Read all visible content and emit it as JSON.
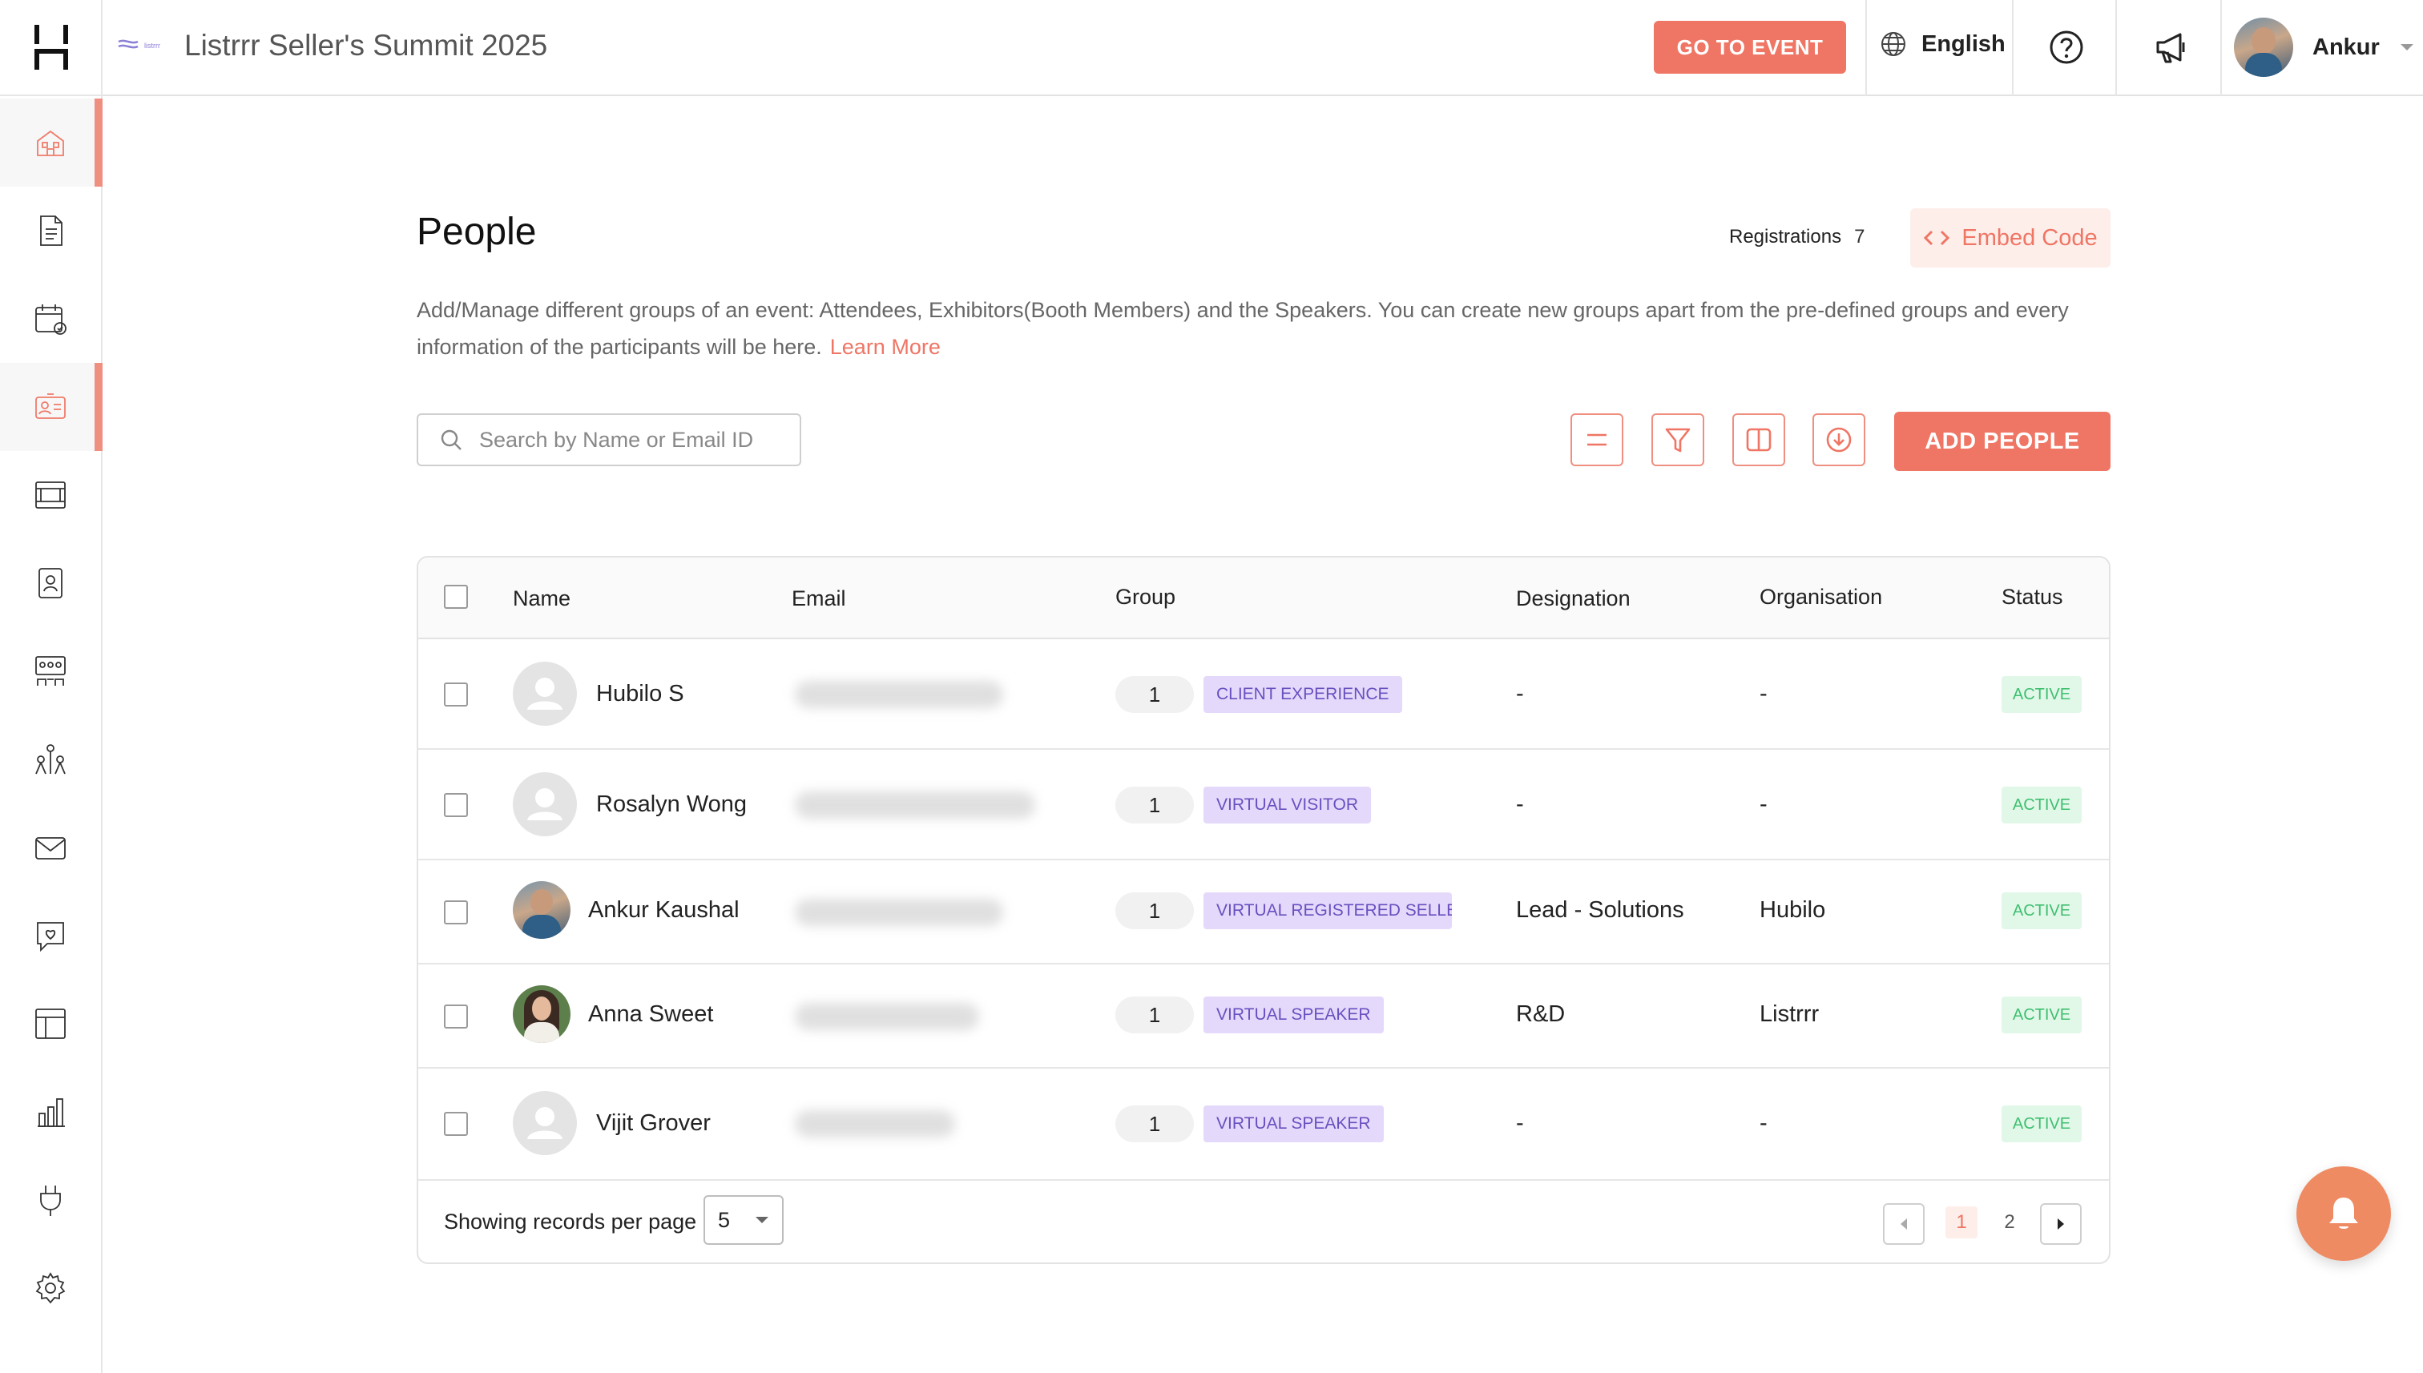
{
  "header": {
    "event_title": "Listrrr Seller's Summit 2025",
    "brand_small": "listrrr",
    "go_to_event": "GO TO EVENT",
    "language": "English",
    "user_name": "Ankur"
  },
  "sidebar": {
    "items": [
      {
        "icon": "event-home-icon",
        "active": true
      },
      {
        "icon": "document-icon",
        "active": false
      },
      {
        "icon": "calendar-icon",
        "active": false
      },
      {
        "icon": "people-card-icon",
        "active": true
      },
      {
        "icon": "booth-icon",
        "active": false
      },
      {
        "icon": "id-badge-icon",
        "active": false
      },
      {
        "icon": "lounge-icon",
        "active": false
      },
      {
        "icon": "networking-icon",
        "active": false
      },
      {
        "icon": "mail-icon",
        "active": false
      },
      {
        "icon": "engagement-icon",
        "active": false
      },
      {
        "icon": "layout-icon",
        "active": false
      },
      {
        "icon": "analytics-icon",
        "active": false
      },
      {
        "icon": "integrations-icon",
        "active": false
      },
      {
        "icon": "settings-icon",
        "active": false
      }
    ]
  },
  "page": {
    "title": "People",
    "registrations_label": "Registrations",
    "registrations_count": "7",
    "embed_code": "Embed Code",
    "description": "Add/Manage different groups of an event: Attendees, Exhibitors(Booth Members) and the Speakers. You can create new groups apart from the pre-defined groups and every information of the participants will be here.",
    "learn_more": "Learn More",
    "search_placeholder": "Search by Name or Email ID",
    "add_people": "ADD PEOPLE"
  },
  "table": {
    "columns": [
      "Name",
      "Email",
      "Group",
      "Designation",
      "Organisation",
      "Status"
    ],
    "rows": [
      {
        "name": "Hubilo S",
        "group_count": "1",
        "group": "CLIENT EXPERIENCE",
        "designation": "-",
        "organisation": "-",
        "status": "ACTIVE"
      },
      {
        "name": "Rosalyn Wong",
        "group_count": "1",
        "group": "VIRTUAL VISITOR",
        "designation": "-",
        "organisation": "-",
        "status": "ACTIVE"
      },
      {
        "name": "Ankur Kaushal",
        "group_count": "1",
        "group": "VIRTUAL REGISTERED SELLER",
        "designation": "Lead - Solutions",
        "organisation": "Hubilo",
        "status": "ACTIVE"
      },
      {
        "name": "Anna Sweet",
        "group_count": "1",
        "group": "VIRTUAL SPEAKER",
        "designation": "R&D",
        "organisation": "Listrrr",
        "status": "ACTIVE"
      },
      {
        "name": "Vijit Grover",
        "group_count": "1",
        "group": "VIRTUAL SPEAKER",
        "designation": "-",
        "organisation": "-",
        "status": "ACTIVE"
      }
    ],
    "footer": {
      "per_page_label": "Showing records per page",
      "per_page_value": "5",
      "pages": [
        "1",
        "2"
      ],
      "current_page": "1"
    }
  },
  "colors": {
    "accent": "#ef7564",
    "group_tag_bg": "#e4d9fb",
    "group_tag_text": "#6a4fbf",
    "status_bg": "#e1f8e9",
    "status_text": "#3fbf6f",
    "bell": "#ef8b63"
  }
}
